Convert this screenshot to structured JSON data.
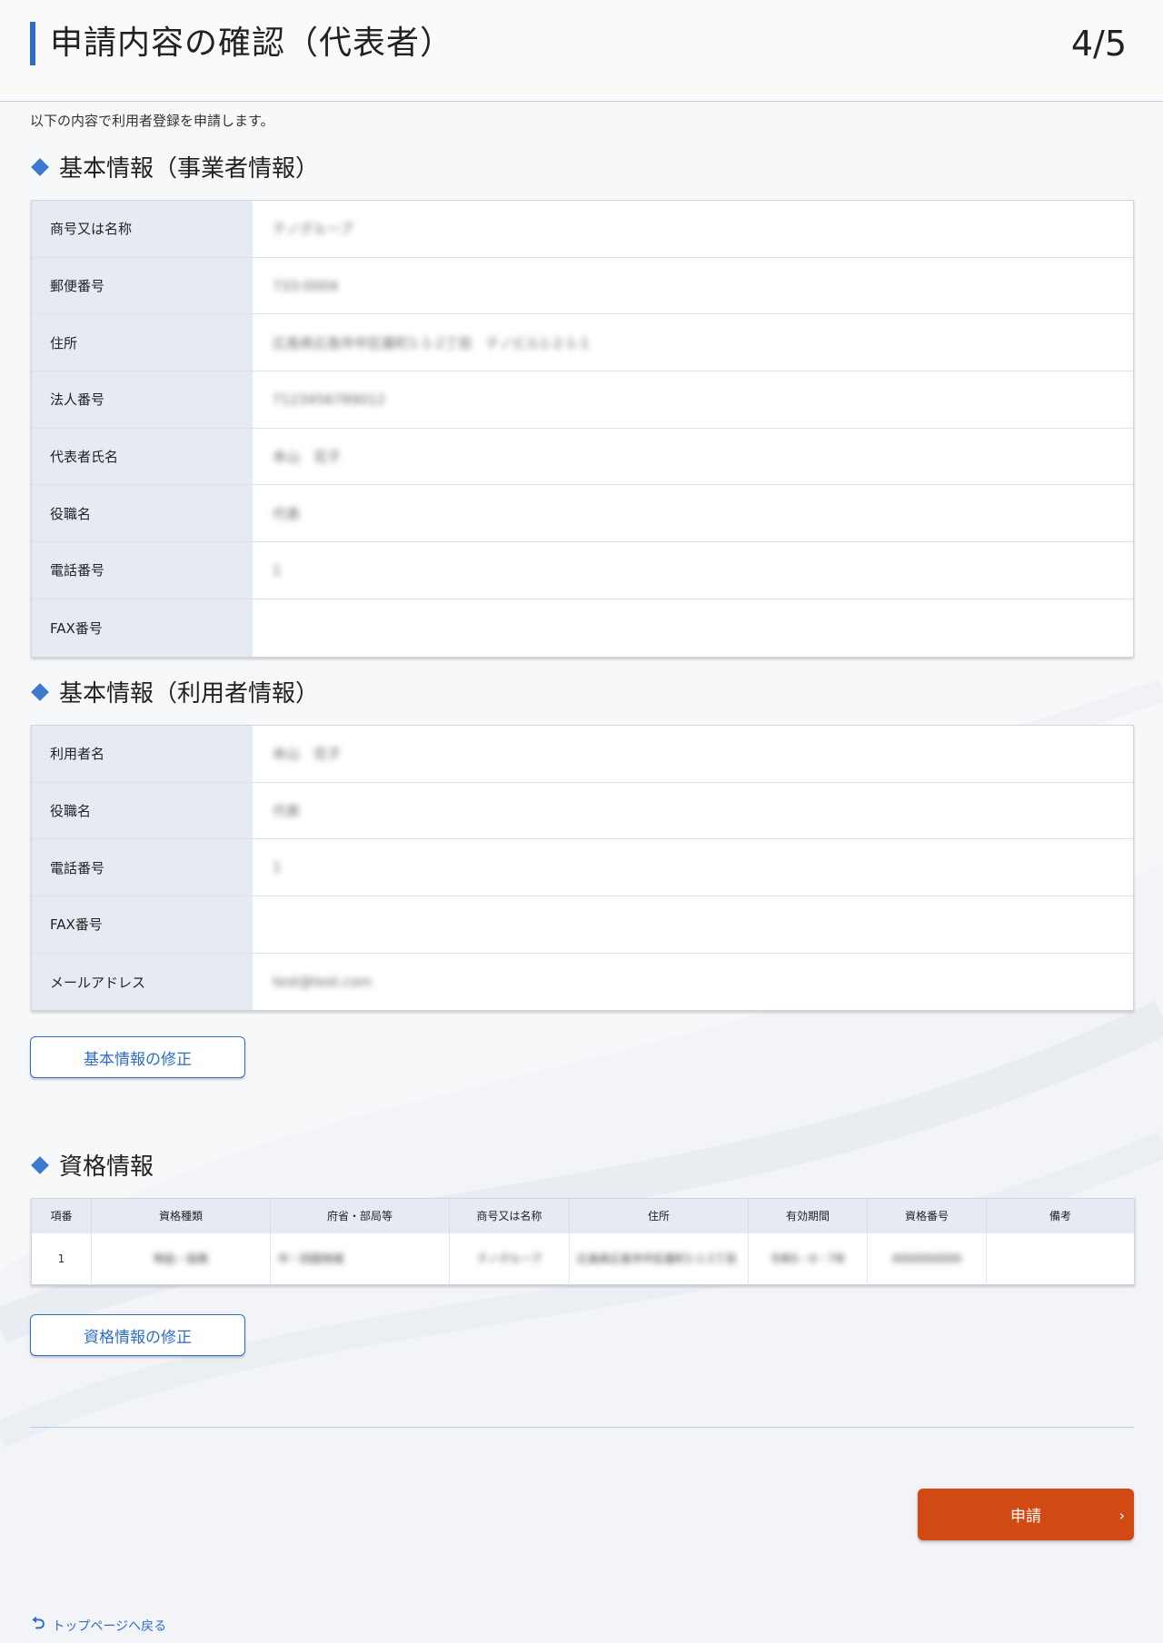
{
  "header": {
    "title": "申請内容の確認（代表者）",
    "step": "4/5"
  },
  "intro": "以下の内容で利用者登録を申請します。",
  "business_section": {
    "title": "基本情報（事業者情報）",
    "rows": [
      {
        "label": "商号又は名称",
        "value": "テノグループ"
      },
      {
        "label": "郵便番号",
        "value": "733-0004"
      },
      {
        "label": "住所",
        "value": "広島県広島市中区基町1-1-2丁目　テノビル1-2-1-1"
      },
      {
        "label": "法人番号",
        "value": "7123456789012"
      },
      {
        "label": "代表者氏名",
        "value": "本山　花子"
      },
      {
        "label": "役職名",
        "value": "代表"
      },
      {
        "label": "電話番号",
        "value": "1"
      },
      {
        "label": "FAX番号",
        "value": ""
      }
    ]
  },
  "user_section": {
    "title": "基本情報（利用者情報）",
    "rows": [
      {
        "label": "利用者名",
        "value": "本山　花子"
      },
      {
        "label": "役職名",
        "value": "代表"
      },
      {
        "label": "電話番号",
        "value": "1"
      },
      {
        "label": "FAX番号",
        "value": ""
      },
      {
        "label": "メールアドレス",
        "value": "test@test.com"
      }
    ],
    "edit_button": "基本情報の修正"
  },
  "qualification_section": {
    "title": "資格情報",
    "headers": [
      "項番",
      "資格種類",
      "府省・部局等",
      "商号又は名称",
      "住所",
      "有効期間",
      "資格番号",
      "備考"
    ],
    "rows": [
      [
        "1",
        "物品・役務",
        "中・四国地域",
        "テノグループ",
        "広島県広島市中区基町1-1-2丁目",
        "令和5・6・7年",
        "0000000000",
        ""
      ]
    ],
    "edit_button": "資格情報の修正"
  },
  "submit_button": "申請",
  "back_link": "トップページへ戻る"
}
